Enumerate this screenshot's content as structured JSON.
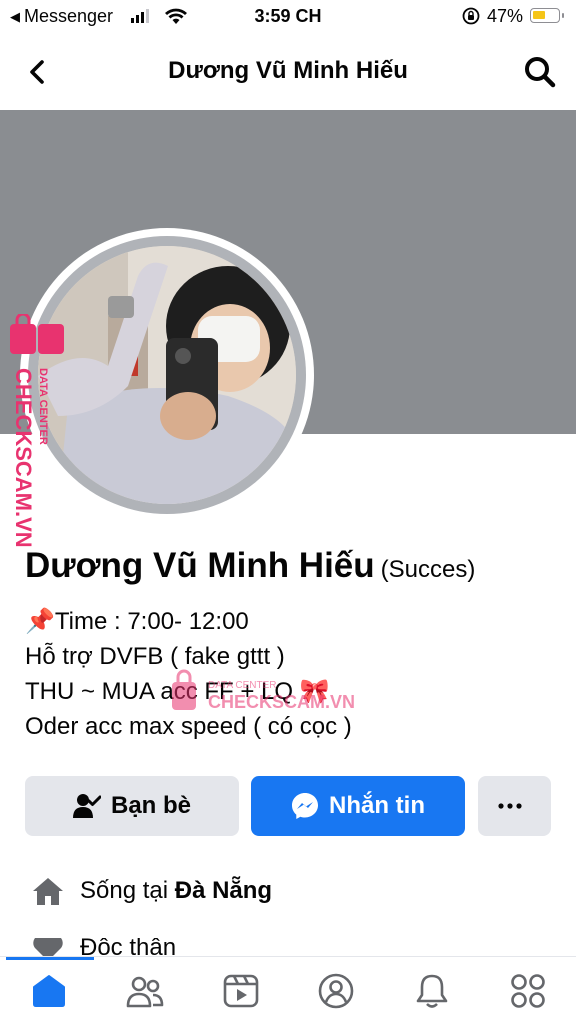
{
  "status_bar": {
    "back_app": "Messenger",
    "time": "3:59 CH",
    "battery_percent": "47%",
    "battery_level": 0.47
  },
  "header": {
    "title": "Dương Vũ Minh Hiếu"
  },
  "profile": {
    "name": "Dương Vũ Minh Hiếu",
    "alt_name": "(Succes)",
    "bio": [
      "📌Time : 7:00- 12:00",
      "Hỗ trợ DVFB ( fake gttt )",
      "THU ~ MUA acc FF + LQ 🎀",
      "Oder acc max speed ( có cọc )"
    ]
  },
  "actions": {
    "friends_label": "Bạn bè",
    "message_label": "Nhắn tin",
    "more_label": "···"
  },
  "info": {
    "lives_prefix": "Sống tại ",
    "lives_place": "Đà Nẵng",
    "relationship": "Độc thân"
  },
  "watermark": {
    "site": "CHECKSCAM.VN",
    "sub": "DATA CENTER"
  },
  "colors": {
    "accent": "#1877f2",
    "cover": "#8a8d91",
    "watermark": "#e8336f"
  },
  "tabbar": {
    "items": [
      "home-icon",
      "friends-icon",
      "video-icon",
      "profile-icon",
      "bell-icon",
      "menu-grid-icon"
    ],
    "active": "home-icon"
  }
}
